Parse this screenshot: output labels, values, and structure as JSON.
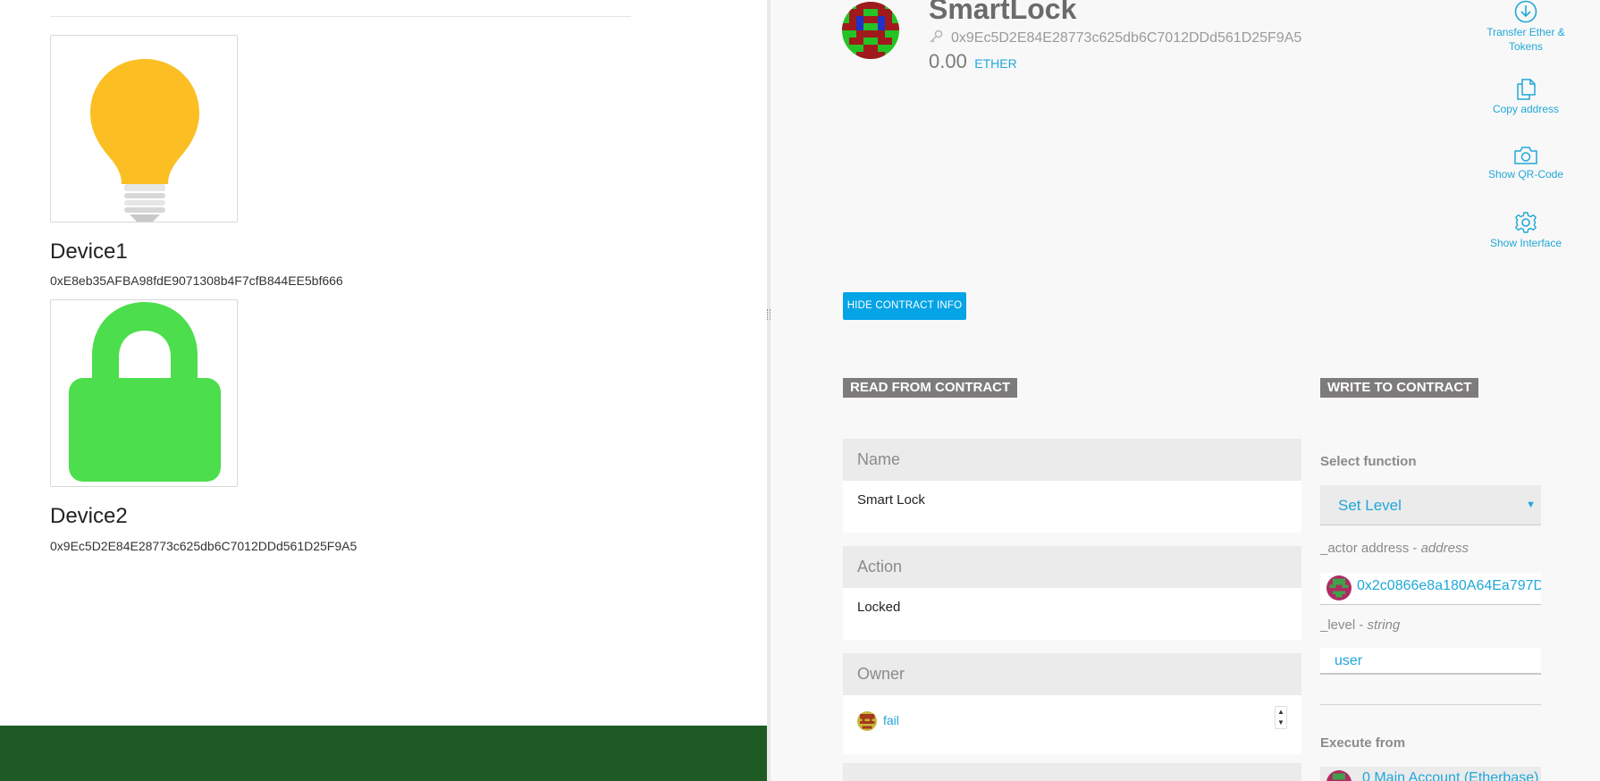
{
  "left_panel": {
    "devices": [
      {
        "name": "Device1",
        "address": "0xE8eb35AFBA98fdE9071308b4F7cfB844EE5bf666",
        "icon": "lightbulb-icon",
        "icon_color": "#fbbf24"
      },
      {
        "name": "Device2",
        "address": "0x9Ec5D2E84E28773c625db6C7012DDd561D25F9A5",
        "icon": "lock-icon",
        "icon_color": "#4cde4c"
      }
    ],
    "footer_color": "#1e5b24"
  },
  "contract": {
    "title": "SmartLock",
    "address": "0x9Ec5D2E84E28773c625db6C7012DDd561D25F9A5",
    "balance": "0.00",
    "unit": "ETHER"
  },
  "side_actions": {
    "transfer": "Transfer Ether & Tokens",
    "copy": "Copy address",
    "qr": "Show QR-Code",
    "interface": "Show Interface"
  },
  "hide_info_button": "HIDE CONTRACT INFO",
  "read": {
    "heading": "READ FROM CONTRACT",
    "fields": [
      {
        "label": "Name",
        "value": "Smart Lock"
      },
      {
        "label": "Action",
        "value": "Locked"
      },
      {
        "label": "Owner",
        "value": "fail"
      }
    ]
  },
  "write": {
    "heading": "WRITE TO CONTRACT",
    "select_label": "Select function",
    "selected_function": "Set Level",
    "actor_param": "_actor address",
    "actor_type": "address",
    "actor_value": "0x2c0866e8a180A64Ea797D",
    "level_param": "_level",
    "level_type": "string",
    "level_value": "user",
    "execute_label": "Execute from",
    "execute_value": "0 Main Account (Etherbase)"
  },
  "colors": {
    "accent": "#20a7d8",
    "button": "#04a4e6",
    "heading_bg": "#7e7b7b"
  }
}
